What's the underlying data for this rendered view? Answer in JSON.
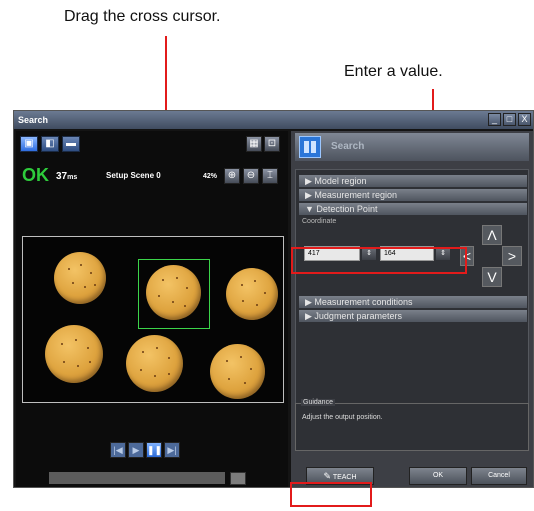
{
  "callouts": {
    "drag_cursor": "Drag the cross cursor.",
    "enter_value": "Enter a value."
  },
  "window": {
    "title": "Search",
    "controls": [
      "_",
      "□",
      "X"
    ]
  },
  "left": {
    "status_ok": "OK",
    "time_value": "37",
    "time_unit": "ms",
    "scene": "Setup Scene 0",
    "zoom": "42%",
    "icons": {
      "toolbar": [
        "monitor-icon",
        "camera-icon",
        "folder-icon"
      ],
      "view": [
        "grid-icon",
        "zoom-window-icon"
      ],
      "zoom": [
        "zoom-in-icon",
        "zoom-out-icon",
        "fit-icon"
      ],
      "playback": [
        "previous-icon",
        "play-icon",
        "pause-icon",
        "next-icon"
      ]
    }
  },
  "right": {
    "header_title": "Search",
    "sections": [
      "▶ Model region",
      "▶ Measurement region",
      "▼ Detection Point",
      "▶ Measurement conditions",
      "▶ Judgment parameters"
    ],
    "coordinate_label": "Coordinate",
    "coord_x": "417",
    "coord_y": "164",
    "arrows": {
      "up": "Λ",
      "down": "V",
      "left": "<",
      "right": ">"
    },
    "guidance_label": "Guidance",
    "guidance_text": "Adjust the output position.",
    "teach": "TEACH",
    "ok": "OK",
    "cancel": "Cancel"
  },
  "colors": {
    "callout_red": "#e21b1b",
    "ok_green": "#2ecc3c",
    "selection_green": "#3bd44a"
  }
}
